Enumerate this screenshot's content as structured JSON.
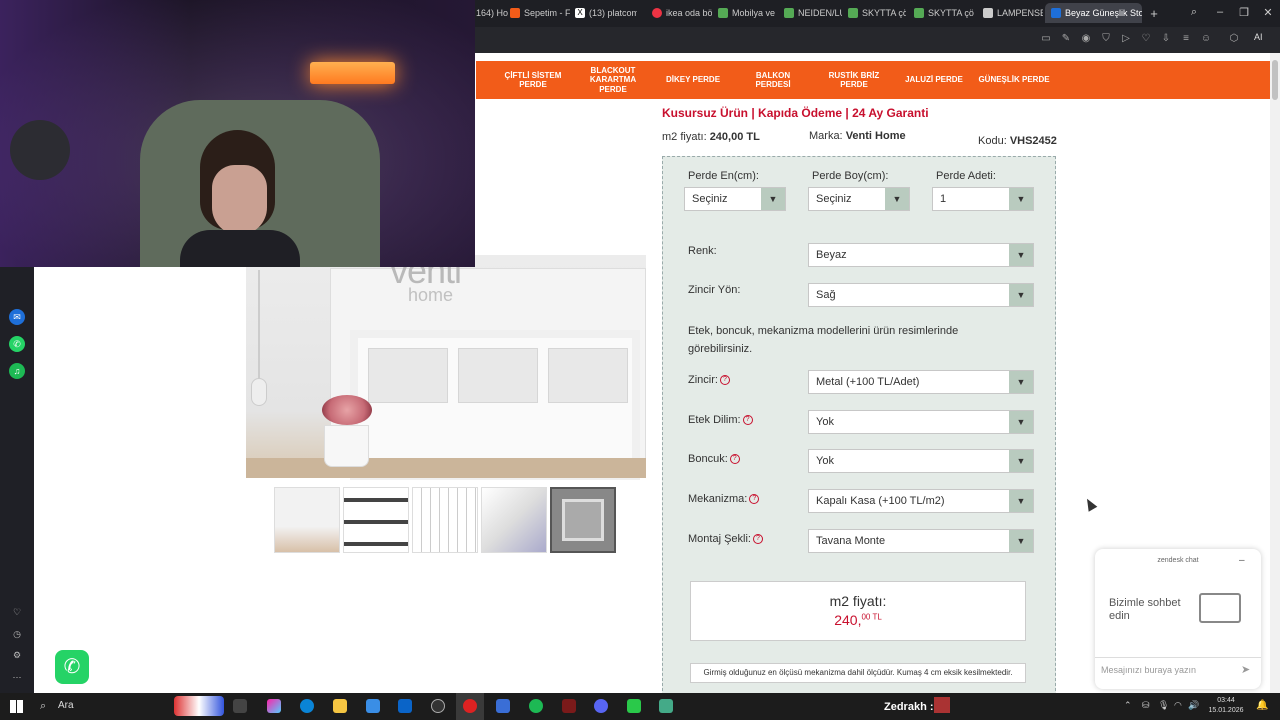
{
  "browser": {
    "tabs": [
      {
        "label": "164) Ho",
        "color": "#888"
      },
      {
        "label": "Sepetim - Fu",
        "color": "#f25c19"
      },
      {
        "label": "(13) platcom",
        "color": "#000"
      },
      {
        "label": "ikea oda böl",
        "color": "#e34"
      },
      {
        "label": "Mobilya ve D",
        "color": "#5a5"
      },
      {
        "label": "NEIDEN/LUR",
        "color": "#5a5"
      },
      {
        "label": "SKYTTA çözü",
        "color": "#5a5"
      },
      {
        "label": "SKYTTA çözü",
        "color": "#5a5"
      },
      {
        "label": "LAMPENSEN",
        "color": "#ccc"
      },
      {
        "label": "Beyaz Güneşlik Stor P",
        "color": "#1e6fd9"
      }
    ],
    "new_tab_label": "+",
    "ai_label": "AI"
  },
  "nav": {
    "items": [
      "ÇİFTLİ SİSTEM PERDE",
      "BLACKOUT KARARTMA PERDE",
      "DİKEY PERDE",
      "BALKON PERDESİ",
      "RUSTİK BRİZ PERDE",
      "JALUZİ PERDE",
      "GÜNEŞLİK PERDE"
    ]
  },
  "product": {
    "tagline": "Kusursuz Ürün | Kapıda Ödeme | 24 Ay Garanti",
    "m2_label": "m2 fiyatı:",
    "m2_value": "240,00 TL",
    "brand_label": "Marka:",
    "brand_value": "Venti Home",
    "code_label": "Kodu:",
    "code_value": "VHS2452",
    "logo_text": "venti",
    "logo_sub": "home"
  },
  "form": {
    "width_label": "Perde En(cm):",
    "width_value": "Seçiniz",
    "height_label": "Perde Boy(cm):",
    "height_value": "Seçiniz",
    "count_label": "Perde Adeti:",
    "count_value": "1",
    "color_label": "Renk:",
    "color_value": "Beyaz",
    "chain_dir_label": "Zincir Yön:",
    "chain_dir_value": "Sağ",
    "info_text": "Etek, boncuk, mekanizma modellerini ürün resimlerinde görebilirsiniz.",
    "chain_label": "Zincir:",
    "chain_value": "Metal (+100 TL/Adet)",
    "skirt_label": "Etek Dilim:",
    "skirt_value": "Yok",
    "bead_label": "Boncuk:",
    "bead_value": "Yok",
    "mech_label": "Mekanizma:",
    "mech_value": "Kapalı Kasa (+100 TL/m2)",
    "mount_label": "Montaj Şekli:",
    "mount_value": "Tavana Monte",
    "price_title": "m2 fiyatı:",
    "price_whole": "240,",
    "price_frac": "00 TL",
    "note": "Girmiş olduğunuz en ölçüsü mekanizma dahil ölçüdür. Kumaş 4 cm eksik kesilmektedir."
  },
  "zendesk": {
    "header": "zendesk chat",
    "title": "Bizimle sohbet edin",
    "placeholder": "Mesajınızı buraya yazın"
  },
  "taskbar": {
    "search": "Ara",
    "user": "Zedrakh :",
    "time": "03:44",
    "date": "15.01.2026"
  },
  "colors": {
    "accent": "#f25c19",
    "tagline": "#c8102e",
    "form_bg": "#e4ebe7"
  }
}
